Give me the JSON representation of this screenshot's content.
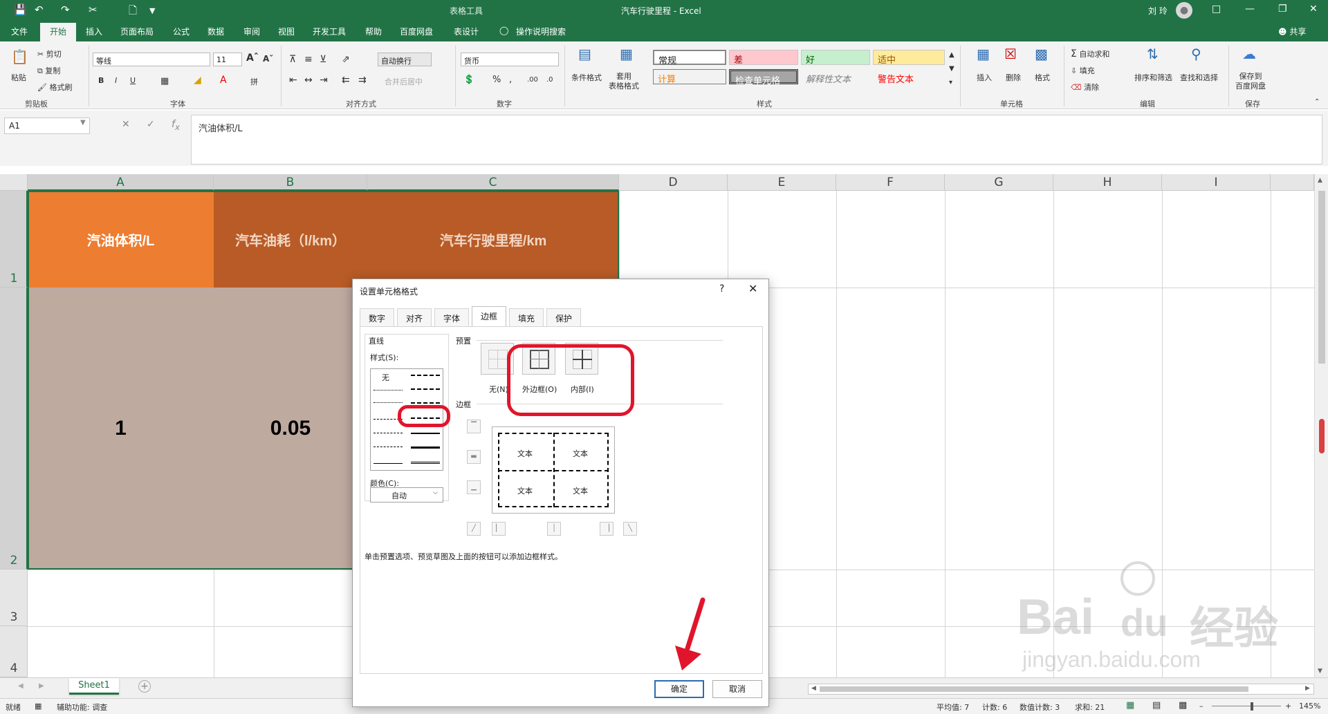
{
  "titlebar": {
    "context": "表格工具",
    "doc_title": "汽车行驶里程 - Excel",
    "user": "刘 玲"
  },
  "tabs": [
    "文件",
    "开始",
    "插入",
    "页面布局",
    "公式",
    "数据",
    "审阅",
    "视图",
    "开发工具",
    "帮助",
    "百度网盘",
    "表设计"
  ],
  "tell_me": "操作说明搜索",
  "share": "共享",
  "ribbon": {
    "clipboard": {
      "paste": "粘贴",
      "cut": "剪切",
      "copy": "复制",
      "format_painter": "格式刷",
      "label": "剪贴板"
    },
    "font": {
      "name": "等线",
      "size": "11",
      "label": "字体"
    },
    "align": {
      "wrap": "自动换行",
      "merge": "合并后居中",
      "label": "对齐方式"
    },
    "number": {
      "format": "货币",
      "label": "数字"
    },
    "styles": {
      "cond_format": "条件格式",
      "table_format": "套用\n表格格式",
      "cells": [
        "常规",
        "差",
        "好",
        "适中",
        "计算",
        "检查单元格",
        "解释性文本",
        "警告文本"
      ],
      "label": "样式"
    },
    "cells": {
      "insert": "插入",
      "delete": "删除",
      "format": "格式",
      "label": "单元格"
    },
    "editing": {
      "autosum": "自动求和",
      "fill": "填充",
      "clear": "清除",
      "sort": "排序和筛选",
      "find": "查找和选择",
      "label": "编辑"
    },
    "save": {
      "save_to": "保存到\n百度网盘",
      "label": "保存"
    }
  },
  "formula": {
    "name_box": "A1",
    "value": "汽油体积/L"
  },
  "columns": [
    "A",
    "B",
    "C",
    "D",
    "E",
    "F",
    "G",
    "H",
    "I"
  ],
  "rows": [
    "1",
    "2",
    "3",
    "4"
  ],
  "cells": {
    "a1": "汽油体积/L",
    "b1": "汽车油耗（l/km）",
    "c1": "汽车行驶里程/km",
    "a2": "1",
    "b2": "0.05"
  },
  "sheet": {
    "name": "Sheet1"
  },
  "status": {
    "ready": "就绪",
    "accessibility": "辅助功能: 调查",
    "average": "平均值: 7",
    "count": "计数: 6",
    "numcount": "数值计数: 3",
    "sum": "求和: 21",
    "zoom": "145%"
  },
  "dialog": {
    "title": "设置单元格格式",
    "help": "?",
    "tabs": [
      "数字",
      "对齐",
      "字体",
      "边框",
      "填充",
      "保护"
    ],
    "line_section": "直线",
    "style_label": "样式(S):",
    "none_style": "无",
    "color_label": "颜色(C):",
    "color_value": "自动",
    "preset_section": "预置",
    "preset_none": "无(N)",
    "preset_outline": "外边框(O)",
    "preset_inside": "内部(I)",
    "border_section": "边框",
    "preview_text": "文本",
    "hint": "单击预置选项、预览草图及上面的按钮可以添加边框样式。",
    "ok": "确定",
    "cancel": "取消"
  },
  "watermark": {
    "brand": "Bai",
    "brand2": "du",
    "cn": "经验",
    "url": "jingyan.baidu.com"
  },
  "colors": {
    "excel_green": "#217346",
    "header_orange": "#ed7d31",
    "header_dark": "#b85b26",
    "body_fill": "#bfaaa0",
    "annotation_red": "#e0152b"
  }
}
